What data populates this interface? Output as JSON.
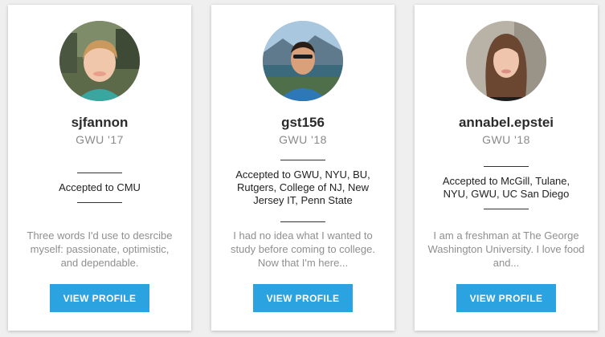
{
  "profiles": [
    {
      "username": "sjfannon",
      "school": "GWU '17",
      "accepted": "Accepted to CMU",
      "bio": "Three words I'd use to desrcibe myself: passionate, optimistic, and dependable.",
      "button_label": "VIEW PROFILE"
    },
    {
      "username": "gst156",
      "school": "GWU '18",
      "accepted": "Accepted to GWU, NYU, BU, Rutgers, College of NJ, New Jersey IT, Penn State",
      "bio": "I had no idea what I wanted to study before coming to college. Now that I'm here...",
      "button_label": "VIEW PROFILE"
    },
    {
      "username": "annabel.epstei",
      "school": "GWU '18",
      "accepted": "Accepted to McGill, Tulane, NYU, GWU, UC San Diego",
      "bio": "I am a freshman at The George Washington University. I love food and...",
      "button_label": "VIEW PROFILE"
    }
  ],
  "colors": {
    "button_bg": "#2aa3e0",
    "page_bg": "#efefef",
    "card_bg": "#ffffff"
  }
}
